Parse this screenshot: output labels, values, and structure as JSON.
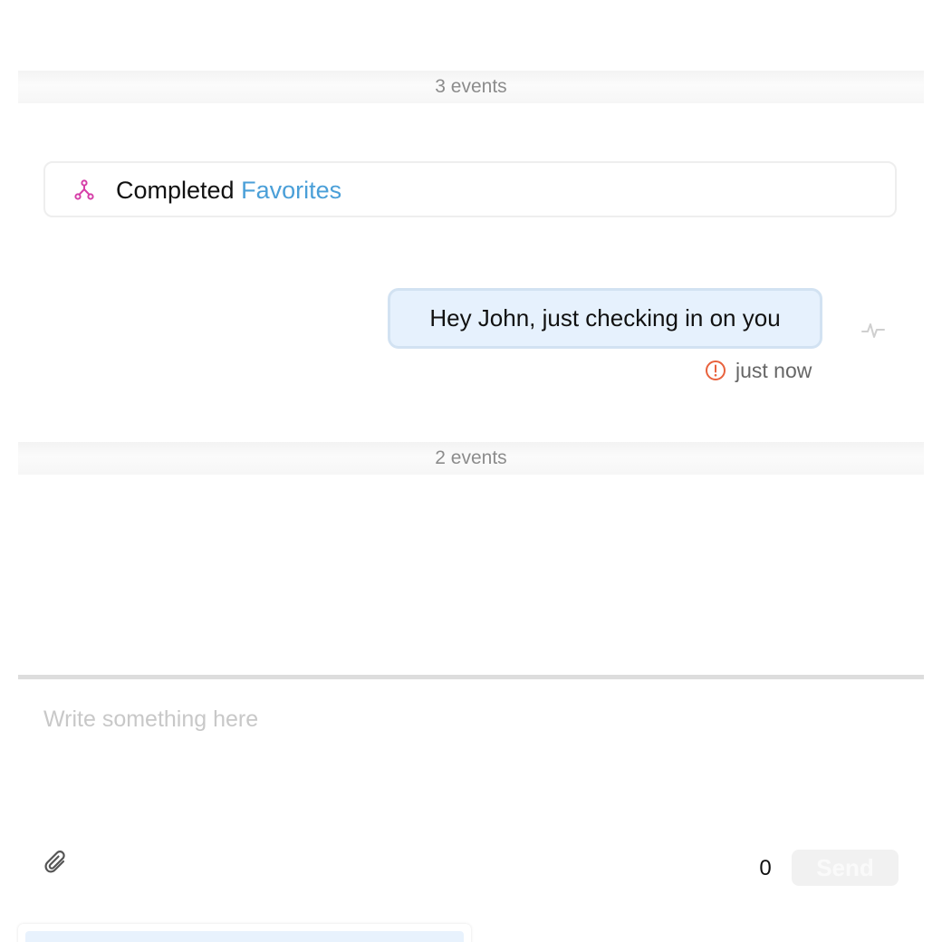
{
  "timeline": {
    "top_events_label": "3 events",
    "bottom_events_label": "2 events"
  },
  "workflow_event": {
    "icon": "workflow-branch-icon",
    "prefix": "Completed",
    "link_label": "Favorites",
    "icon_color": "#d63fa8",
    "link_color": "#4a9fd8"
  },
  "message": {
    "text": "Hey John, just checking in on you",
    "status_icon": "error-circle-icon",
    "status_color": "#e8613c",
    "timestamp": "just now",
    "bubble_color": "#e6f1fd",
    "side_icon": "activity-pulse-icon"
  },
  "composer": {
    "placeholder": "Write something here",
    "value": "",
    "attach_icon": "paperclip-icon",
    "char_count": "0",
    "send_label": "Send"
  }
}
